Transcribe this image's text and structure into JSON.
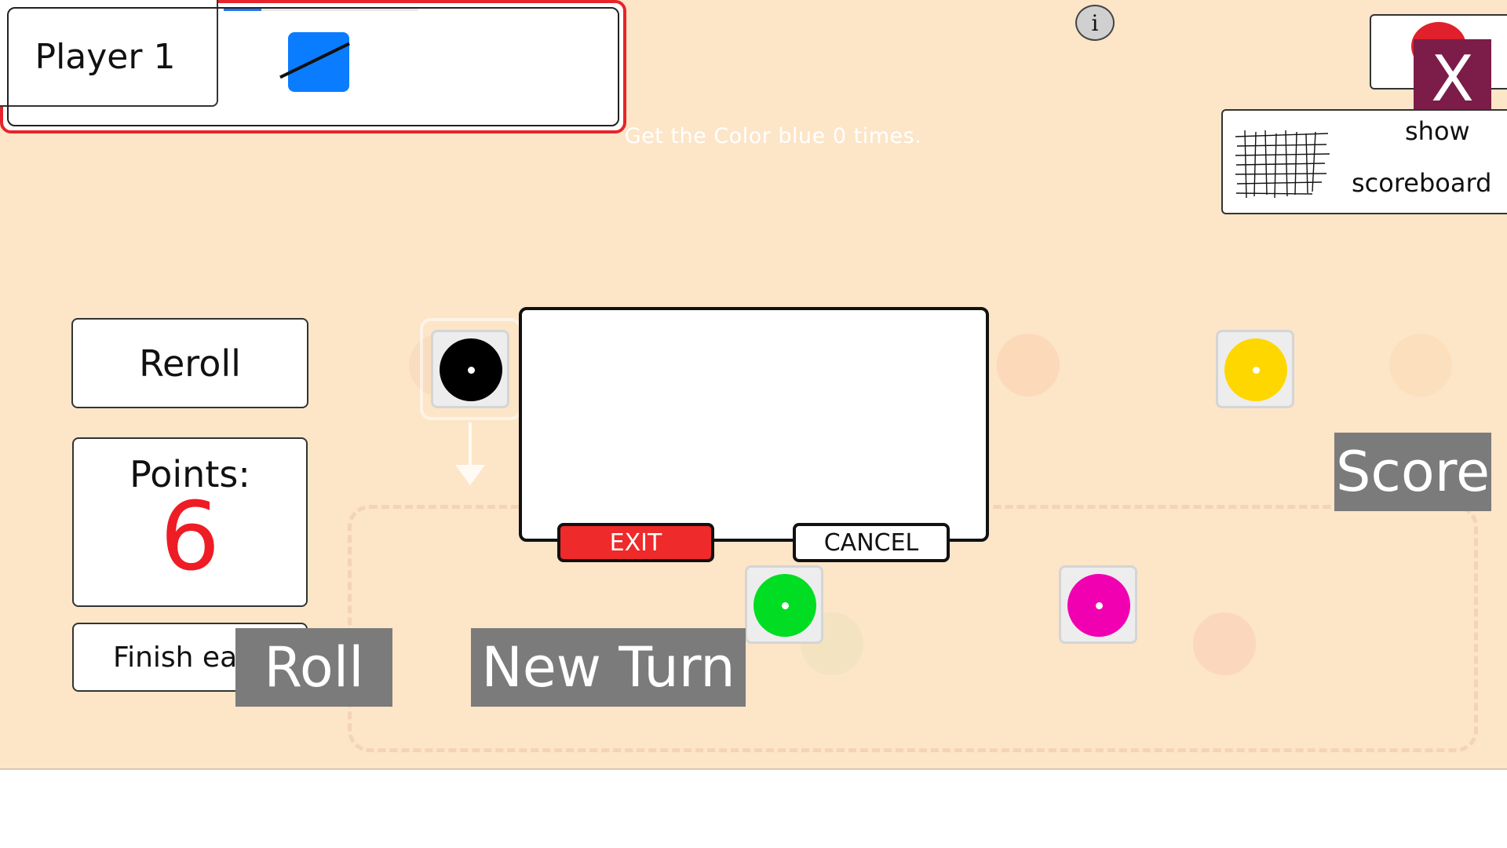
{
  "player": {
    "label": "Player 1"
  },
  "goal": {
    "text": "Get the Color blue 0 times.",
    "color_name": "blue",
    "swatch_color": "#0a7cff",
    "count": 0,
    "frame_color": "#e8242b"
  },
  "info_button": {
    "label": "i"
  },
  "close_button": {
    "label": "X"
  },
  "scoreboard_button": {
    "show": "show",
    "label": "scoreboard",
    "icon": "scoreboard-grid-icon"
  },
  "left_panel": {
    "reroll": "Reroll",
    "points_label": "Points:",
    "points_value": "6",
    "finish": "Finish early"
  },
  "actions": {
    "roll": "Roll",
    "new_turn": "New Turn",
    "score": "Score"
  },
  "dialog": {
    "exit": "EXIT",
    "cancel": "CANCEL"
  },
  "dice": [
    {
      "color": "black",
      "hex": "#000000",
      "location": "selected"
    },
    {
      "color": "yellow",
      "hex": "#ffd700",
      "location": "rolled"
    },
    {
      "color": "green",
      "hex": "#00dd22",
      "location": "tray"
    },
    {
      "color": "magenta",
      "hex": "#f000b0",
      "location": "tray"
    }
  ],
  "colors": {
    "background": "#fde5c8",
    "accent_red": "#ee1c25",
    "label_gray": "#7b7b7b",
    "close_purple": "#7c1c48"
  }
}
